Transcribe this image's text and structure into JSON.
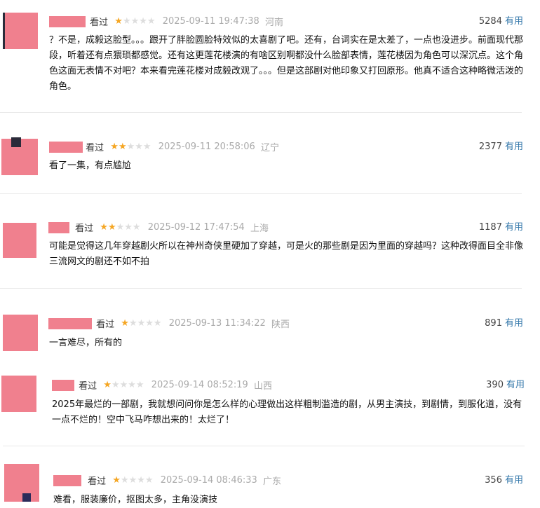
{
  "reviews": [
    {
      "seen": "看过",
      "rating": 1,
      "time": "2025-09-11 19:47:38",
      "location": "河南",
      "votes": "5284",
      "useful": "有用",
      "content": "？不是，成毅这脸型。。。跟开了胖脸圆脸特效似的太喜剧了吧。还有，台词实在是太差了，一点也没进步。前面现代那段，听着还有点猥琐都感觉。还有这更莲花楼演的有啥区别啊都没什么脸部表情，莲花楼因为角色可以深沉点。这个角色这面无表情不对吧？本来看完莲花楼对成毅改观了。。。但是这部剧对他印象又打回原形。他真不适合这种略微活泼的角色。"
    },
    {
      "seen": "看过",
      "rating": 2,
      "time": "2025-09-11 20:58:06",
      "location": "辽宁",
      "votes": "2377",
      "useful": "有用",
      "content": "看了一集，有点尴尬"
    },
    {
      "seen": "看过",
      "rating": 2,
      "time": "2025-09-12 17:47:54",
      "location": "上海",
      "votes": "1187",
      "useful": "有用",
      "content": "可能是觉得这几年穿越剧火所以在神州奇侠里硬加了穿越，可是火的那些剧是因为里面的穿越吗？这种改得面目全非像三流网文的剧还不如不拍"
    },
    {
      "seen": "看过",
      "rating": 1,
      "time": "2025-09-13 11:34:22",
      "location": "陕西",
      "votes": "891",
      "useful": "有用",
      "content": "一言难尽，所有的"
    },
    {
      "seen": "看过",
      "rating": 1,
      "time": "2025-09-14 08:52:19",
      "location": "山西",
      "votes": "390",
      "useful": "有用",
      "content": "2025年最烂的一部剧，我就想问问你是怎么样的心理做出这样粗制滥造的剧，从男主演技，到剧情，到服化道，没有一点不烂的！空中飞马咋想出来的！太烂了！"
    },
    {
      "seen": "看过",
      "rating": 1,
      "time": "2025-09-14 08:46:33",
      "location": "广东",
      "votes": "356",
      "useful": "有用",
      "content": "难看，服装廉价，抠图太多，主角没演技"
    }
  ]
}
